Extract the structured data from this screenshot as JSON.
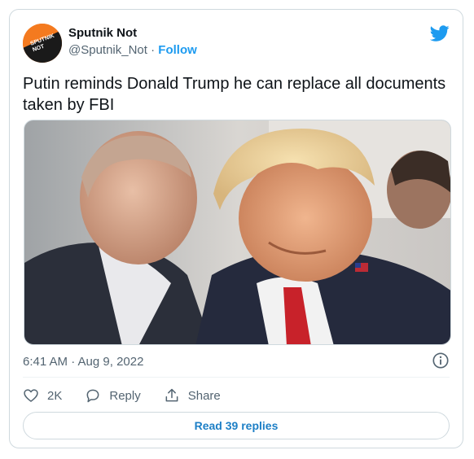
{
  "author": {
    "name": "Sputnik Not",
    "handle": "@Sputnik_Not",
    "separator": "·",
    "follow_label": "Follow",
    "avatar_text": "SPUTNIK NOT"
  },
  "tweet": {
    "text": "Putin reminds Donald Trump he can replace all documents taken by FBI",
    "timestamp": "6:41 AM · Aug 9, 2022"
  },
  "actions": {
    "likes_count": "2K",
    "reply_label": "Reply",
    "share_label": "Share"
  },
  "footer": {
    "read_replies_label": "Read 39 replies"
  },
  "icons": {
    "brand": "twitter-bird-icon",
    "like": "heart-icon",
    "reply": "reply-bubble-icon",
    "share": "share-upload-icon",
    "info": "info-icon"
  },
  "colors": {
    "accent": "#1d9bf0",
    "text": "#0f1419",
    "muted": "#536471",
    "border": "#cfd9de",
    "avatar_bg": "#f47a1f"
  }
}
